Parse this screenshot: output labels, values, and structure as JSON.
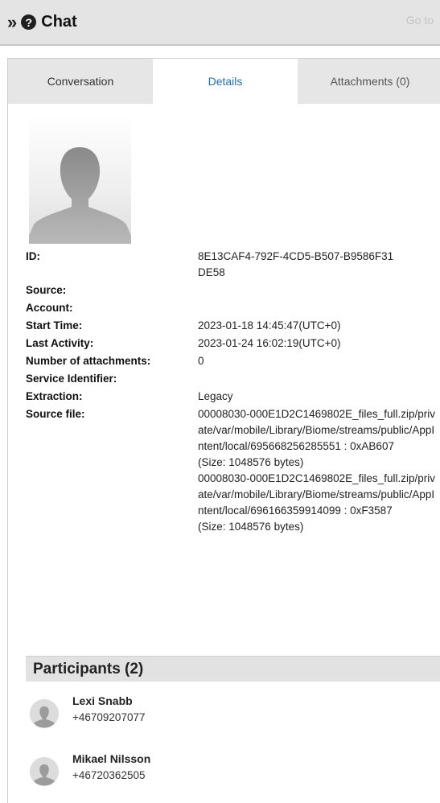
{
  "header": {
    "expand_icon": "double-chevron-right-icon",
    "help_icon": "question-circle-icon",
    "help_glyph": "?",
    "title": "Chat",
    "goto_label": "Go to"
  },
  "tabs": [
    {
      "label": "Conversation",
      "active": false
    },
    {
      "label": "Details",
      "active": true
    },
    {
      "label": "Attachments (0)",
      "active": false
    }
  ],
  "colors": {
    "active_tab_text": "#1f6fb5",
    "tab_bar_bg": "#e6e6e6",
    "header_bg": "#e4e4e4"
  },
  "details": {
    "id_label": "ID:",
    "id_value": "8E13CAF4-792F-4CD5-B507-B9586F31DE58",
    "source_label": "Source:",
    "source_value": "",
    "account_label": "Account:",
    "account_value": "",
    "start_label": "Start Time:",
    "start_value": "2023-01-18 14:45:47(UTC+0)",
    "last_label": "Last Activity:",
    "last_value": "2023-01-24 16:02:19(UTC+0)",
    "attachments_label": "Number of attachments:",
    "attachments_value": "0",
    "service_label": "Service Identifier:",
    "service_value": "",
    "extraction_label": "Extraction:",
    "extraction_value": "Legacy",
    "sourcefile_label": "Source file:",
    "sourcefile_1": "00008030-000E1D2C1469802E_files_full.zip/private/var/mobile/Library/Biome/streams/public/AppIntent/local/695668256285551 : 0xAB607",
    "sourcefile_1_size": "(Size: 1048576 bytes)",
    "sourcefile_2": "00008030-000E1D2C1469802E_files_full.zip/private/var/mobile/Library/Biome/streams/public/AppIntent/local/696166359914099 : 0xF3587",
    "sourcefile_2_size": "(Size: 1048576 bytes)"
  },
  "participants": {
    "header": "Participants (2)",
    "items": [
      {
        "name": "Lexi Snabb",
        "phone": "+46709207077"
      },
      {
        "name": "Mikael Nilsson",
        "phone": "+46720362505"
      }
    ]
  }
}
